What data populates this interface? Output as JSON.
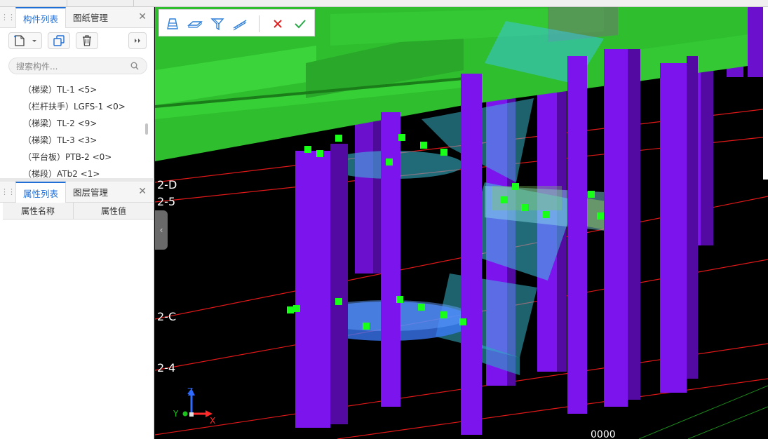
{
  "top_panel": {
    "tabs": [
      {
        "label": "构件列表",
        "active": true
      },
      {
        "label": "图纸管理",
        "active": false
      }
    ],
    "search_placeholder": "搜索构件...",
    "components": [
      "（梯梁）TL-1 <5>",
      "（栏杆扶手）LGFS-1 <0>",
      "（梯梁）TL-2 <9>",
      "（梯梁）TL-3 <3>",
      "（平台板）PTB-2 <0>",
      "（梯段）ATb2 <1>"
    ]
  },
  "bottom_panel": {
    "tabs": [
      {
        "label": "属性列表",
        "active": true
      },
      {
        "label": "图层管理",
        "active": false
      }
    ],
    "columns": [
      "属性名称",
      "属性值"
    ]
  },
  "icons": {
    "close": "close-icon",
    "new": "new-component-icon",
    "copy": "copy-icon",
    "delete": "trash-icon",
    "more": "double-chevron-right-icon",
    "search": "search-icon"
  },
  "viewport": {
    "grid_labels": [
      "2-D",
      "2-5",
      "2-C",
      "2-4"
    ],
    "axis": {
      "x": "X",
      "y": "Y",
      "z": "Z"
    },
    "bottom_number": "0000",
    "colors": {
      "beam": "#2ebe2e",
      "column": "#7c14ee",
      "stair": "#3cc3dc",
      "grip": "#19ff19",
      "grid": "#e01818"
    }
  },
  "viewport_toolbar": {
    "tools": [
      "stair-flight-icon",
      "platform-slab-icon",
      "stair-beam-icon",
      "railing-icon"
    ],
    "cancel": "cancel-icon",
    "confirm": "confirm-icon"
  }
}
